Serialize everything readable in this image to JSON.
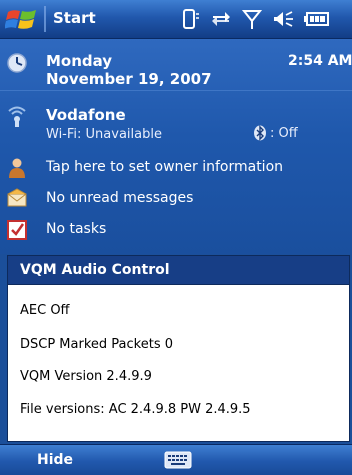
{
  "titlebar": {
    "start_label": "Start",
    "icons": [
      "phone-icon",
      "sync-icon",
      "signal-icon",
      "volume-icon",
      "battery-icon"
    ]
  },
  "today": {
    "date_day": "Monday",
    "date_full": "November 19, 2007",
    "time": "2:54 AM",
    "carrier": "Vodafone",
    "wifi_status": "Wi-Fi: Unavailable",
    "bluetooth_status": ": Off",
    "owner_info": "Tap here to set owner information",
    "messages": "No unread messages",
    "tasks": "No tasks"
  },
  "popup": {
    "title": "VQM Audio Control",
    "lines": [
      "AEC Off",
      "DSCP Marked Packets 0",
      "VQM Version 2.4.9.9",
      "File versions: AC 2.4.9.8 PW 2.4.9.5"
    ]
  },
  "menubar": {
    "left_softkey": "Hide",
    "input_icon": "keyboard-icon"
  },
  "colors": {
    "titlebar": "#2158ad",
    "background": "#1f58ac",
    "popup_header": "#173e86",
    "popup_body": "#ffffff"
  }
}
